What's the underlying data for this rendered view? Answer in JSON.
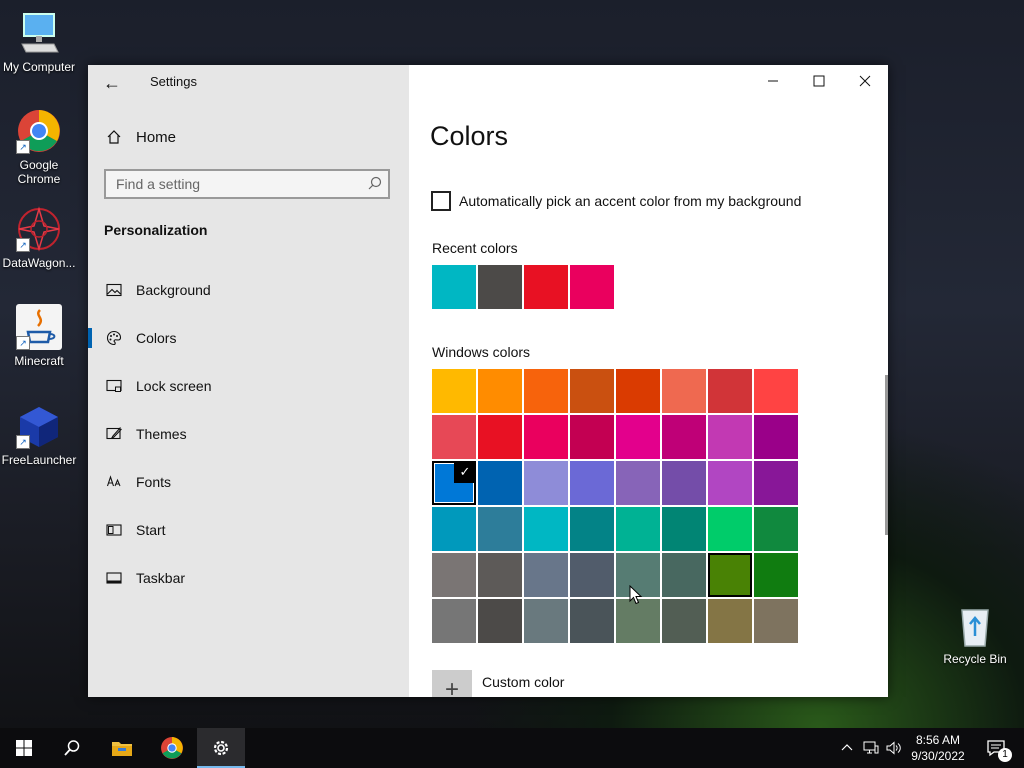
{
  "desktop": {
    "icons": [
      {
        "label": "My Computer"
      },
      {
        "label": "Google Chrome"
      },
      {
        "label": "DataWagon..."
      },
      {
        "label": "Minecraft"
      },
      {
        "label": "FreeLauncher"
      },
      {
        "label": "Recycle Bin"
      }
    ]
  },
  "window": {
    "app_title": "Settings",
    "controls": {
      "minimize": "minimize-icon",
      "maximize": "maximize-icon",
      "close": "close-icon"
    }
  },
  "sidebar": {
    "home_label": "Home",
    "search": {
      "placeholder": "Find a setting"
    },
    "section_title": "Personalization",
    "items": [
      {
        "label": "Background",
        "icon": "picture-icon"
      },
      {
        "label": "Colors",
        "icon": "palette-icon",
        "selected": true
      },
      {
        "label": "Lock screen",
        "icon": "lock-screen-icon"
      },
      {
        "label": "Themes",
        "icon": "brush-icon"
      },
      {
        "label": "Fonts",
        "icon": "fonts-icon"
      },
      {
        "label": "Start",
        "icon": "start-icon"
      },
      {
        "label": "Taskbar",
        "icon": "taskbar-icon"
      }
    ]
  },
  "content": {
    "page_title": "Colors",
    "auto_accent_label": "Automatically pick an accent color from my background",
    "auto_accent_checked": false,
    "recent_colors_label": "Recent colors",
    "recent_colors": [
      "#00b7c3",
      "#4c4a48",
      "#e81123",
      "#ea005e"
    ],
    "windows_colors_label": "Windows colors",
    "windows_colors": [
      "#ffb900",
      "#ff8c00",
      "#f7630c",
      "#ca5010",
      "#da3b01",
      "#ef6950",
      "#d13438",
      "#ff4343",
      "#e74856",
      "#e81123",
      "#ea005e",
      "#c30052",
      "#e3008c",
      "#bf0077",
      "#c239b3",
      "#9a0089",
      "#0078d7",
      "#0063b1",
      "#8e8cd8",
      "#6b69d6",
      "#8764b8",
      "#744da9",
      "#b146c2",
      "#881798",
      "#0099bc",
      "#2d7d9a",
      "#00b7c3",
      "#038387",
      "#00b294",
      "#018574",
      "#00cc6a",
      "#10893e",
      "#7a7574",
      "#5d5a58",
      "#68768a",
      "#515c6b",
      "#567c73",
      "#486860",
      "#498205",
      "#107c10",
      "#767676",
      "#4c4a48",
      "#69797e",
      "#4a5459",
      "#647c64",
      "#525e54",
      "#847545",
      "#7e735f"
    ],
    "selected_color": "#0078d7",
    "hovered_color": "#498205",
    "custom_color_label": "Custom color"
  },
  "taskbar": {
    "apps": [
      "start-icon",
      "search-icon",
      "file-explorer-icon",
      "chrome-icon",
      "settings-icon"
    ],
    "active_app": "settings-icon",
    "clock": {
      "time": "8:56 AM",
      "date": "9/30/2022"
    },
    "notification_count": "1"
  }
}
